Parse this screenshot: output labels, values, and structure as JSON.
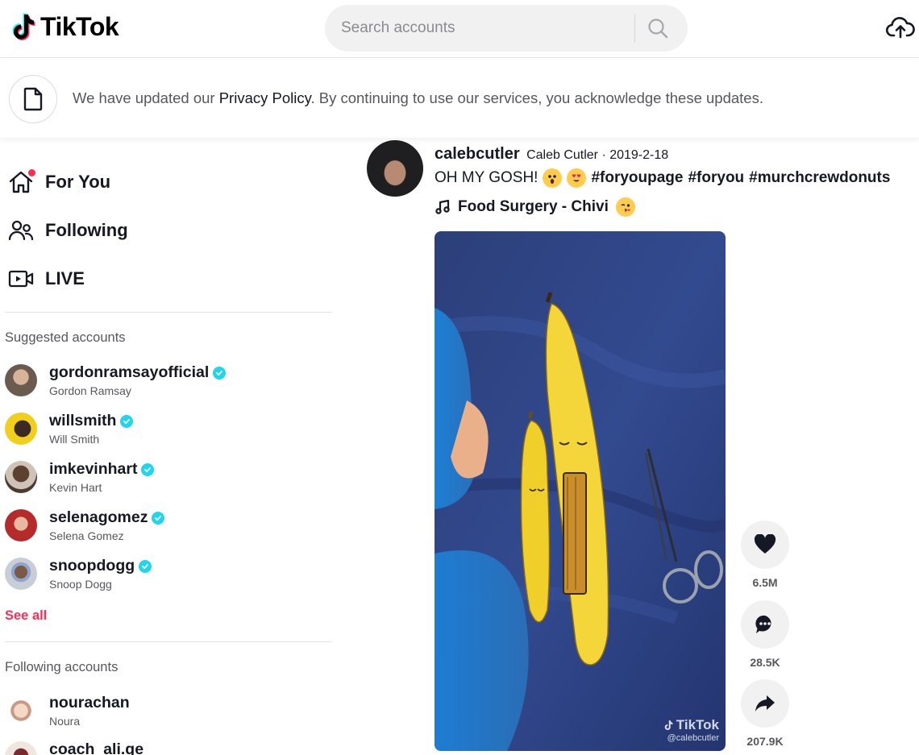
{
  "header": {
    "logo_text": "TikTok",
    "search_placeholder": "Search accounts"
  },
  "banner": {
    "text_before": "We have updated our ",
    "link": "Privacy Policy",
    "text_after": ". By continuing to use our services, you acknowledge these updates."
  },
  "sidebar": {
    "nav": [
      {
        "label": "For You",
        "icon": "home-icon"
      },
      {
        "label": "Following",
        "icon": "users-icon"
      },
      {
        "label": "LIVE",
        "icon": "live-icon"
      }
    ],
    "suggested_title": "Suggested accounts",
    "suggested": [
      {
        "username": "gordonramsayofficial",
        "name": "Gordon Ramsay",
        "verified": true,
        "avatar_color": "#6b5a4e"
      },
      {
        "username": "willsmith",
        "name": "Will Smith",
        "verified": true,
        "avatar_color": "#f2cf1d"
      },
      {
        "username": "imkevinhart",
        "name": "Kevin Hart",
        "verified": true,
        "avatar_color": "#4a3a30"
      },
      {
        "username": "selenagomez",
        "name": "Selena Gomez",
        "verified": true,
        "avatar_color": "#b52a2a"
      },
      {
        "username": "snoopdogg",
        "name": "Snoop Dogg",
        "verified": true,
        "avatar_color": "#c9cdd6"
      }
    ],
    "see_all": "See all",
    "following_title": "Following accounts",
    "following": [
      {
        "username": "nourachan",
        "name": "Noura",
        "avatar_color": "#e9d6c8"
      },
      {
        "username": "coach_ali.ge",
        "name": "",
        "avatar_color": "#7a2a2a"
      }
    ]
  },
  "post": {
    "username": "calebcutler",
    "meta": "Caleb Cutler · 2019-2-18",
    "caption_text": "OH MY GOSH!",
    "hashtags": [
      "#foryoupage",
      "#foryou",
      "#murchcrewdonuts"
    ],
    "music": "Food Surgery - Chivi",
    "watermark_title": "TikTok",
    "watermark_handle": "@calebcutler",
    "likes": "6.5M",
    "comments": "28.5K",
    "shares": "207.9K"
  },
  "colors": {
    "accent": "#fe2c55",
    "verified": "#20d5ec",
    "text": "#161823"
  }
}
